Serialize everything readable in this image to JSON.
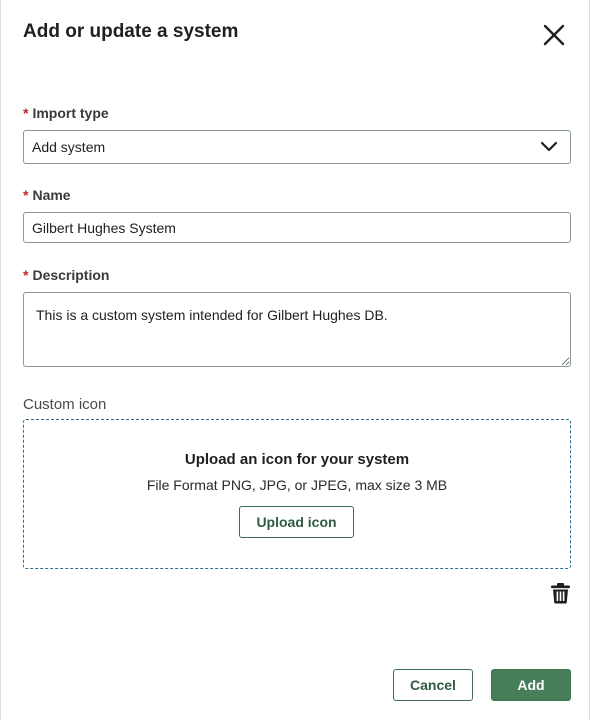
{
  "dialog": {
    "title": "Add or update a system",
    "close_icon": "close-icon"
  },
  "form": {
    "required_marker": "*",
    "import_type": {
      "label": "Import type",
      "value": "Add system",
      "icon": "chevron-down-icon"
    },
    "name": {
      "label": "Name",
      "value": "Gilbert Hughes System"
    },
    "description": {
      "label": "Description",
      "value": "This is a custom system intended for Gilbert Hughes DB."
    },
    "custom_icon": {
      "label": "Custom icon",
      "upload_title": "Upload an icon for your system",
      "upload_hint": "File Format PNG, JPG, or JPEG, max size 3 MB",
      "upload_button": "Upload icon",
      "delete_icon": "trash-icon"
    }
  },
  "footer": {
    "cancel_label": "Cancel",
    "add_label": "Add"
  },
  "colors": {
    "primary": "#467e59",
    "required": "#c0221f",
    "dropzone_border": "#2f6b8f"
  }
}
